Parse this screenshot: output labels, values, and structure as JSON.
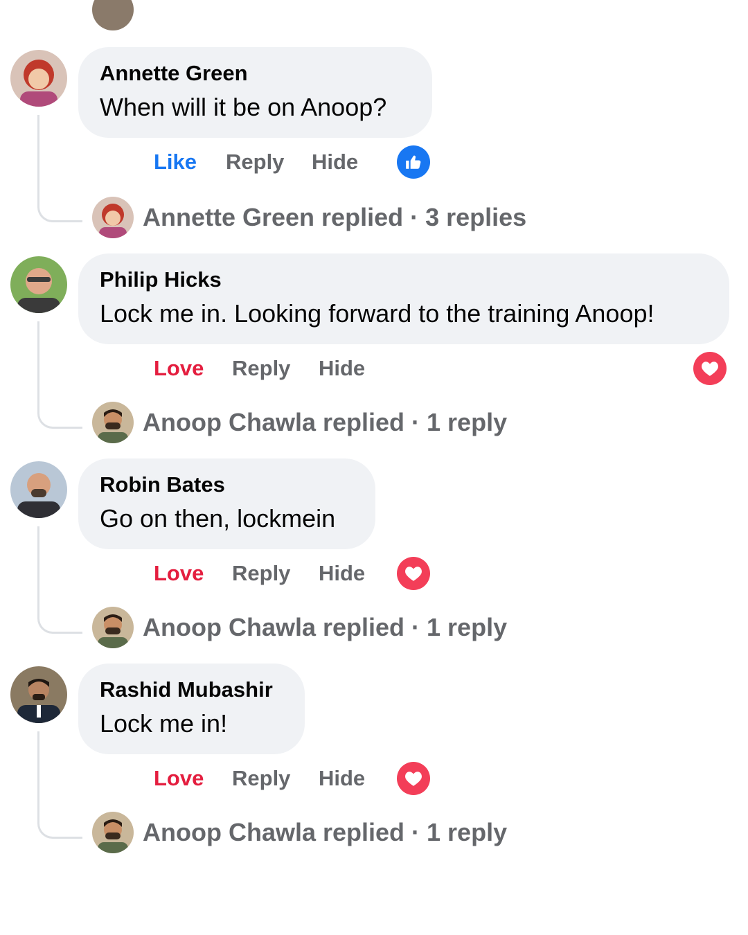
{
  "colors": {
    "like_blue": "#1877f2",
    "love_red": "#e41e3f",
    "secondary_text": "#65676b",
    "bubble_bg": "#f0f2f5"
  },
  "comments": [
    {
      "author": "Annette Green",
      "text": "When will it be on Anoop?",
      "reaction_label": "Like",
      "reaction_icon": "thumbs-up-icon",
      "reply_label": "Reply",
      "hide_label": "Hide",
      "replied_summary": "Annette Green replied · 3 replies"
    },
    {
      "author": "Philip Hicks",
      "text": "Lock me in. Looking forward to the training Anoop!",
      "reaction_label": "Love",
      "reaction_icon": "heart-icon",
      "reply_label": "Reply",
      "hide_label": "Hide",
      "replied_summary": "Anoop Chawla replied · 1 reply"
    },
    {
      "author": "Robin Bates",
      "text": "Go on then, lockmein",
      "reaction_label": "Love",
      "reaction_icon": "heart-icon",
      "reply_label": "Reply",
      "hide_label": "Hide",
      "replied_summary": "Anoop Chawla replied · 1 reply"
    },
    {
      "author": "Rashid Mubashir",
      "text": "Lock me in!",
      "reaction_label": "Love",
      "reaction_icon": "heart-icon",
      "reply_label": "Reply",
      "hide_label": "Hide",
      "replied_summary": "Anoop Chawla replied · 1 reply"
    }
  ]
}
